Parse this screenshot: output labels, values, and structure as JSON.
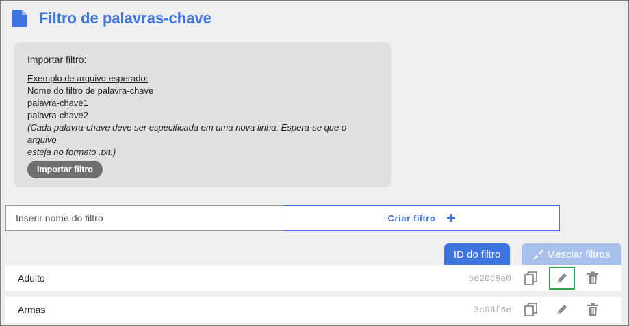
{
  "header": {
    "title": "Filtro de palavras-chave",
    "icon": "document-icon"
  },
  "import": {
    "title": "Importar filtro:",
    "example_head": "Exemplo de arquivo esperado:",
    "lines": [
      "Nome do filtro de palavra-chave",
      "palavra-chave1",
      "palavra-chave2"
    ],
    "note_line1": "(Cada palavra-chave deve ser especificada em uma nova linha. Espera-se que o arquivo",
    "note_line2": "esteja no formato .txt.)",
    "button_label": "Importar filtro"
  },
  "create": {
    "input_placeholder": "Inserir nome do filtro",
    "input_value": "",
    "button_label": "Criar filtro"
  },
  "table": {
    "id_tab_label": "ID do filtro",
    "merge_label": "Mesclar filtros",
    "rows": [
      {
        "name": "Adulto",
        "id": "5e20c9a0"
      },
      {
        "name": "Armas",
        "id": "3c96f6e"
      }
    ]
  },
  "colors": {
    "accent": "#3d74e0",
    "merge_disabled": "#a8c0ec",
    "focus_outline": "#2fa14a",
    "panel_bg": "#e0e0e0",
    "page_bg": "#efefef"
  }
}
